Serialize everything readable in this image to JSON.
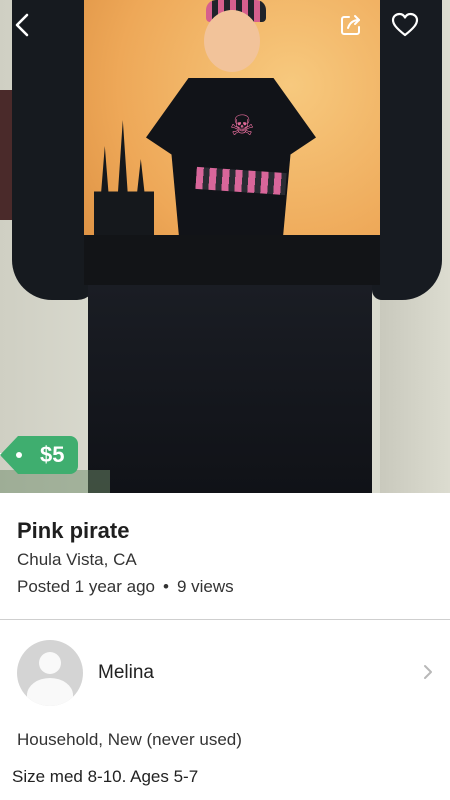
{
  "listing": {
    "price": "$5",
    "title": "Pink pirate",
    "location": "Chula Vista, CA",
    "posted": "Posted 1 year ago",
    "separator": "•",
    "views": "9 views",
    "condition": "Household, New (never used)",
    "description": "Size med 8-10.  Ages 5-7"
  },
  "seller": {
    "name": "Melina"
  },
  "header": {
    "back_icon": "chevron-left-icon",
    "share_icon": "share-icon",
    "favorite_icon": "heart-icon"
  },
  "colors": {
    "price_badge": "#3fae6f",
    "divider": "#cfcfcf",
    "text": "#333333"
  }
}
